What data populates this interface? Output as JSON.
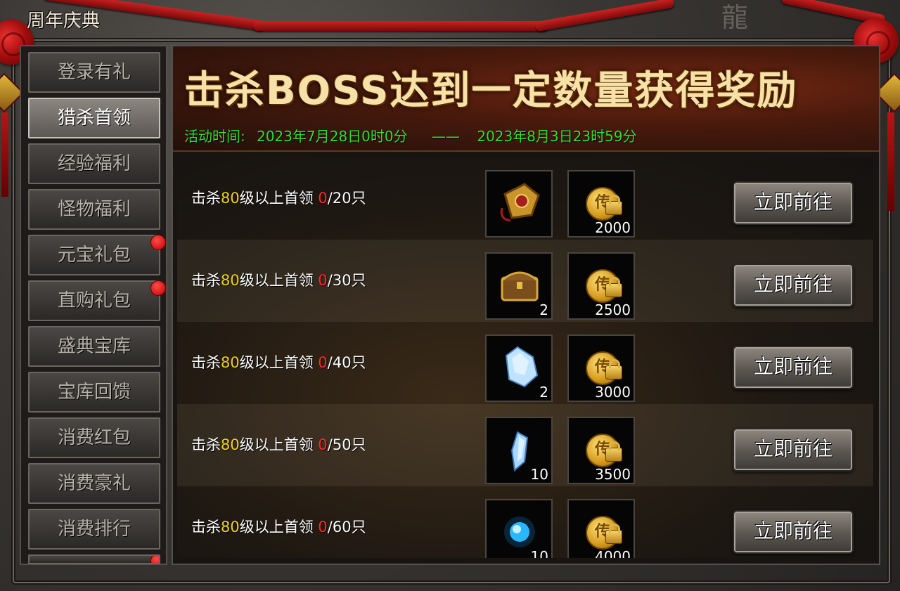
{
  "window": {
    "title": "周年庆典"
  },
  "sidebar": {
    "items": [
      {
        "label": "登录有礼",
        "active": false,
        "badge": false
      },
      {
        "label": "猎杀首领",
        "active": true,
        "badge": false
      },
      {
        "label": "经验福利",
        "active": false,
        "badge": false
      },
      {
        "label": "怪物福利",
        "active": false,
        "badge": false
      },
      {
        "label": "元宝礼包",
        "active": false,
        "badge": true
      },
      {
        "label": "直购礼包",
        "active": false,
        "badge": true
      },
      {
        "label": "盛典宝库",
        "active": false,
        "badge": false
      },
      {
        "label": "宝库回馈",
        "active": false,
        "badge": false
      },
      {
        "label": "消费红包",
        "active": false,
        "badge": false
      },
      {
        "label": "消费豪礼",
        "active": false,
        "badge": false
      },
      {
        "label": "消费排行",
        "active": false,
        "badge": false
      }
    ]
  },
  "banner": {
    "title": "击杀BOSS达到一定数量获得奖励",
    "time_label": "活动时间:",
    "start": "2023年7月28日0时0分",
    "separator": "——",
    "end": "2023年8月3日23时59分"
  },
  "tasks": [
    {
      "prefix": "击杀",
      "level": "80",
      "mid": "级以上首领 ",
      "current": "0",
      "target": "/20只",
      "item_icon": "amulet-icon",
      "item_count": "",
      "coin_count": "2000",
      "button": "立即前往"
    },
    {
      "prefix": "击杀",
      "level": "80",
      "mid": "级以上首领 ",
      "current": "0",
      "target": "/30只",
      "item_icon": "treasure-chest-icon",
      "item_count": "2",
      "coin_count": "2500",
      "button": "立即前往"
    },
    {
      "prefix": "击杀",
      "level": "80",
      "mid": "级以上首领 ",
      "current": "0",
      "target": "/40只",
      "item_icon": "crystal-cluster-icon",
      "item_count": "2",
      "coin_count": "3000",
      "button": "立即前往"
    },
    {
      "prefix": "击杀",
      "level": "80",
      "mid": "级以上首领 ",
      "current": "0",
      "target": "/50只",
      "item_icon": "crystal-shard-icon",
      "item_count": "10",
      "coin_count": "3500",
      "button": "立即前往"
    },
    {
      "prefix": "击杀",
      "level": "80",
      "mid": "级以上首领 ",
      "current": "0",
      "target": "/60只",
      "item_icon": "blue-orb-icon",
      "item_count": "10",
      "coin_count": "4000",
      "button": "立即前往"
    }
  ],
  "coin_glyph": "传",
  "colors": {
    "time_green": "#2fe02f",
    "level_yellow": "#f2d21a",
    "progress_red": "#ff2a2a",
    "badge_red": "#e00000"
  }
}
